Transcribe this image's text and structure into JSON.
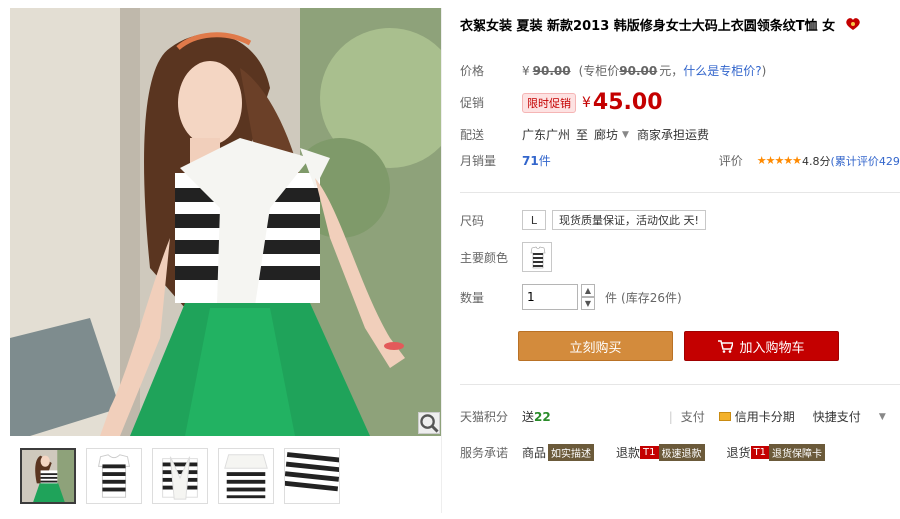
{
  "product": {
    "title": "衣絮女装 夏装 新款2013 韩版修身女士大码上衣圆领条纹T恤 女"
  },
  "price": {
    "label": "价格",
    "currency": "¥",
    "original": "90.00",
    "note_prefix": "(专柜价",
    "note_value": "90.00",
    "note_suffix": "元，",
    "note_link": "什么是专柜价?",
    "note_close": ")"
  },
  "promo": {
    "label": "促销",
    "badge": "限时促销",
    "currency": "¥",
    "price": "45.00"
  },
  "shipping": {
    "label": "配送",
    "from": "广东广州",
    "to_word": "至",
    "destination": "廊坊",
    "fee": "商家承担运费"
  },
  "sales": {
    "label": "月销量",
    "count": "71",
    "unit": "件",
    "rating_label": "评价",
    "stars": "★★★★★",
    "rating": "4.8分",
    "rating_count": "(累计评价429"
  },
  "size": {
    "label": "尺码",
    "option": "L",
    "notice": "现货质量保证，活动仅此 天!"
  },
  "color": {
    "label": "主要颜色"
  },
  "quantity": {
    "label": "数量",
    "value": "1",
    "unit": "件",
    "stock": "(库存26件)"
  },
  "actions": {
    "buy_now": "立刻购买",
    "add_cart": "加入购物车"
  },
  "points": {
    "label": "天猫积分",
    "text": "送",
    "value": "22",
    "pay_label": "支付",
    "credit": "信用卡分期",
    "express": "快捷支付"
  },
  "service": {
    "label": "服务承诺",
    "item1_prefix": "商品",
    "item1_tag": "如实描述",
    "item2_prefix": "退款",
    "item2_tag_num": "T1",
    "item2_tag": "极速退款",
    "item3_prefix": "退货",
    "item3_tag_num": "T1",
    "item3_tag": "退货保障卡"
  },
  "colors": {
    "accent_red": "#c40000",
    "buy_orange": "#d38b3c",
    "link_blue": "#3366cc",
    "skirt_green": "#1fa35a"
  }
}
